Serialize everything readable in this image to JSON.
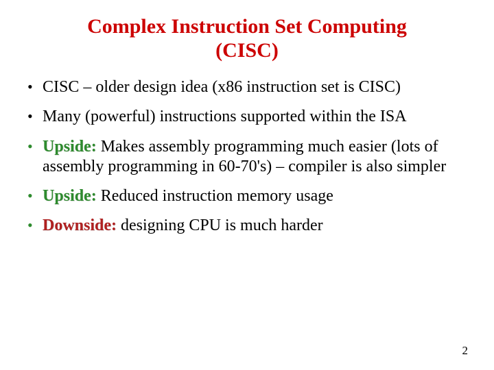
{
  "title": {
    "line1": "Complex Instruction Set Computing",
    "line2": "(CISC)"
  },
  "bullets": [
    {
      "label": "",
      "text": "CISC – older design idea (x86 instruction set is CISC)",
      "labelClass": "",
      "dotClass": "dot-black"
    },
    {
      "label": "",
      "text": "Many (powerful) instructions supported within the ISA",
      "labelClass": "",
      "dotClass": "dot-black"
    },
    {
      "label": "Upside: ",
      "text": "Makes assembly programming much easier (lots of assembly programming in 60-70's) – compiler is also simpler",
      "labelClass": "label-upside",
      "dotClass": "dot-green"
    },
    {
      "label": "Upside: ",
      "text": "Reduced instruction memory usage",
      "labelClass": "label-upside",
      "dotClass": "dot-green"
    },
    {
      "label": "Downside: ",
      "text": "designing CPU is much harder",
      "labelClass": "label-downside",
      "dotClass": "dot-green"
    }
  ],
  "pageNumber": "2"
}
